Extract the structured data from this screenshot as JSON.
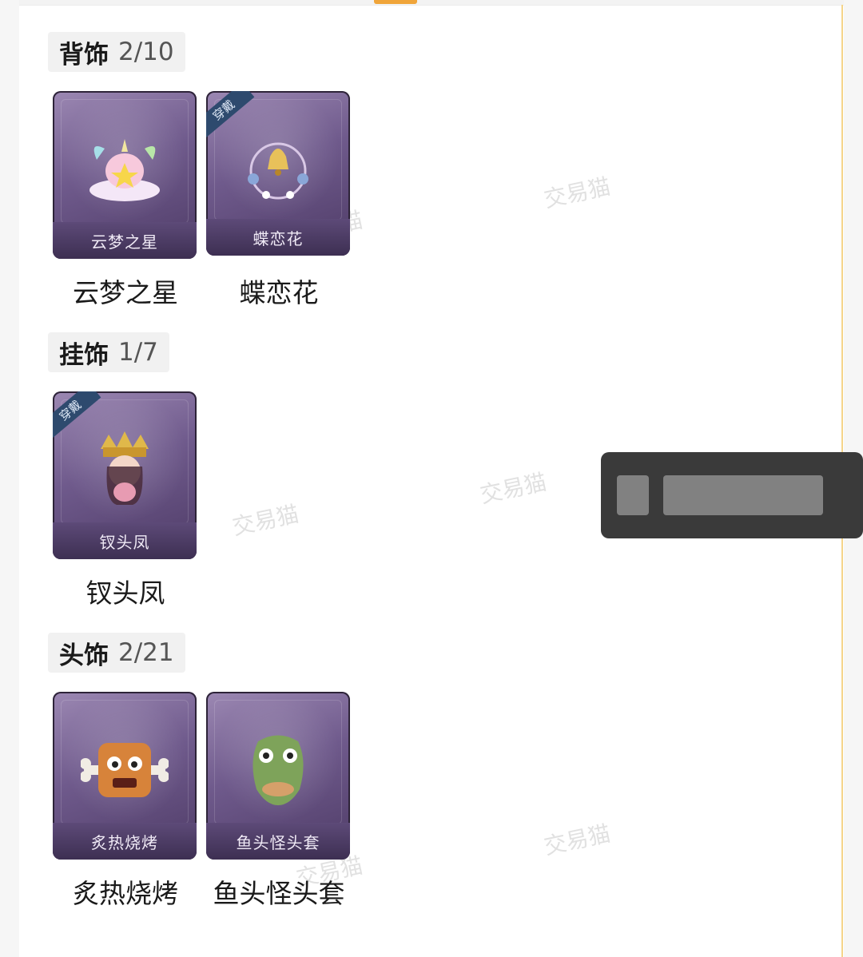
{
  "sections": [
    {
      "name": "背饰",
      "count": "2/10",
      "items": [
        {
          "label": "云梦之星",
          "card_text": "云梦之星",
          "badge": ""
        },
        {
          "label": "蝶恋花",
          "card_text": "蝶恋花",
          "badge": "穿戴"
        }
      ]
    },
    {
      "name": "挂饰",
      "count": "1/7",
      "items": [
        {
          "label": "钗头凤",
          "card_text": "钗头凤",
          "badge": "穿戴"
        }
      ]
    },
    {
      "name": "头饰",
      "count": "2/21",
      "items": [
        {
          "label": "炙热烧烤",
          "card_text": "炙热烧烤",
          "badge": ""
        },
        {
          "label": "鱼头怪头套",
          "card_text": "鱼头怪头套",
          "badge": ""
        }
      ]
    }
  ],
  "watermark_text": "交易猫",
  "colors": {
    "accent": "#f0a53a",
    "card_purple": "#6f5a8c",
    "badge_blue": "#2e4a6e"
  }
}
